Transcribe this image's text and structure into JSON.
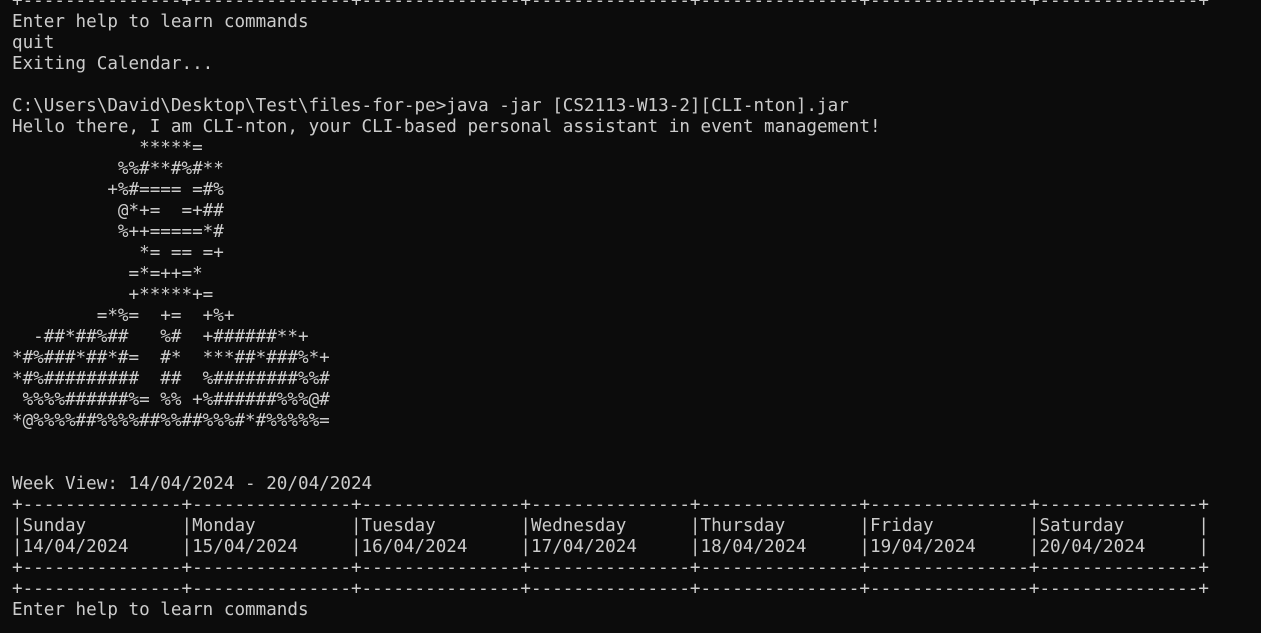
{
  "terminal": {
    "colors": {
      "background": "#0c0c0c",
      "foreground": "#cccccc"
    },
    "lines": [
      "+---------------+---------------+---------------+---------------+---------------+---------------+---------------+",
      "Enter help to learn commands",
      "quit",
      "Exiting Calendar...",
      "",
      "C:\\Users\\David\\Desktop\\Test\\files-for-pe>java -jar [CS2113-W13-2][CLI-nton].jar",
      "Hello there, I am CLI-nton, your CLI-based personal assistant in event management!",
      "            *****=",
      "          %%#**#%#**",
      "         +%#==== =#%",
      "          @*+=  =+##",
      "          %++=====*#",
      "            *= == =+",
      "           =*=++=*",
      "           +*****+=",
      "        =*%=  +=  +%+",
      "  -##*##%##   %#  +######**+",
      "*#%###*##*#=  #*  ***##*###%*+",
      "*#%#########  ##  %########%%#",
      " %%%%######%= %% +%######%%%@#",
      "*@%%%%##%%%%##%%##%%%#*#%%%%%=",
      "",
      "",
      "Week View: 14/04/2024 - 20/04/2024",
      "+---------------+---------------+---------------+---------------+---------------+---------------+---------------+",
      "|Sunday         |Monday         |Tuesday        |Wednesday      |Thursday       |Friday         |Saturday       |",
      "|14/04/2024     |15/04/2024     |16/04/2024     |17/04/2024     |18/04/2024     |19/04/2024     |20/04/2024     |",
      "+---------------+---------------+---------------+---------------+---------------+---------------+---------------+",
      "+---------------+---------------+---------------+---------------+---------------+---------------+---------------+",
      "Enter help to learn commands"
    ]
  }
}
